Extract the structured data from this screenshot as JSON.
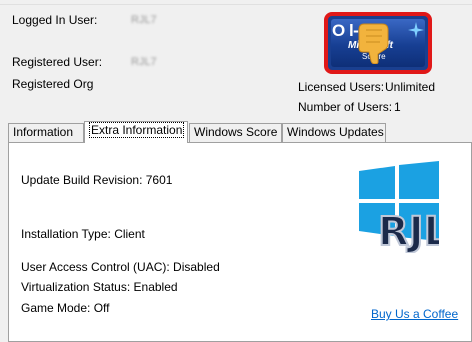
{
  "header": {
    "logged_in_label": "Logged In User:",
    "logged_in_value": "RJL7",
    "registered_user_label": "Registered User:",
    "registered_user_value": "RJL7",
    "registered_org_label": "Registered Org",
    "licensed_users_label": "Licensed Users:",
    "licensed_users_value": "Unlimited",
    "number_users_label": "Number of Users:",
    "number_users_value": "1"
  },
  "badge": {
    "line1": "O    l-",
    "line2": "Microsoft",
    "line3": "So    are",
    "border_color": "#e01818",
    "icon": "thumbs-down-icon"
  },
  "tabs": [
    {
      "label": "Information"
    },
    {
      "label": "Extra Information"
    },
    {
      "label": "Windows Score"
    },
    {
      "label": "Windows Updates"
    }
  ],
  "active_tab": "Extra Information",
  "extra_info": {
    "build_label": "Update Build Revision:",
    "build_value": "7601",
    "install_type_label": "Installation Type:",
    "install_type_value": "Client",
    "uac_label": "User Access Control (UAC):",
    "uac_value": "Disabled",
    "virtualization_label": "Virtualization Status:",
    "virtualization_value": "Enabled",
    "game_mode_label": "Game Mode:",
    "game_mode_value": "Off",
    "logo_text": "RJL",
    "coffee_link": "Buy Us a Coffee"
  },
  "colors": {
    "windows_blue": "#1ba1e2",
    "link": "#0066cc"
  }
}
